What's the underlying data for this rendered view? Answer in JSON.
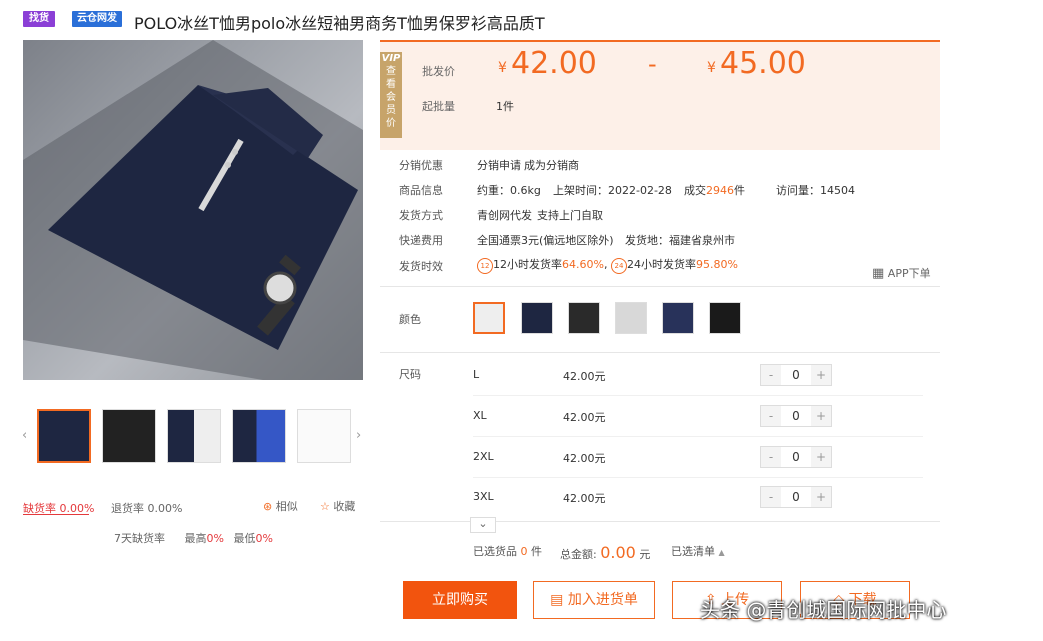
{
  "header": {
    "badge1": "找货",
    "badge2": "云仓网发",
    "title": "POLO冰丝T恤男polo冰丝短袖男商务T恤男保罗衫高品质T"
  },
  "price": {
    "vip_tag": "VIP",
    "vip_lines": [
      "查",
      "看",
      "会",
      "员",
      "价"
    ],
    "wholesale_label": "批发价",
    "currency": "¥",
    "low": "42.00",
    "dash": "-",
    "high": "45.00",
    "min_label": "起批量",
    "min_value": "1件"
  },
  "info": {
    "distribution_label": "分销优惠",
    "distribution_link": "分销申请",
    "distribution_text": "成为分销商",
    "goods_label": "商品信息",
    "weight": "约重：0.6kg",
    "listed": "上架时间：2022-02-28",
    "deals_prefix": "成交",
    "deals_count": "2946",
    "deals_suffix": "件",
    "visits": "访问量：14504",
    "ship_method_label": "发货方式",
    "ship_method_link": "青创网代发",
    "ship_method_text": "支持上门自取",
    "express_label": "快递费用",
    "express_text": "全国通票3元(偏远地区除外)",
    "origin": "发货地：福建省泉州市",
    "timeliness_label": "发货时效",
    "t12_icon": "12",
    "t12_text": "12小时发货率",
    "t12_rate": "64.60%",
    "sep": ",",
    "t24_icon": "24",
    "t24_text": "24小时发货率",
    "t24_rate": "95.80%",
    "app_order": "APP下单"
  },
  "color": {
    "label": "颜色"
  },
  "sizes": {
    "label": "尺码",
    "rows": [
      {
        "size": "L",
        "price": "42.00元",
        "qty": "0"
      },
      {
        "size": "XL",
        "price": "42.00元",
        "qty": "0"
      },
      {
        "size": "2XL",
        "price": "42.00元",
        "qty": "0"
      },
      {
        "size": "3XL",
        "price": "42.00元",
        "qty": "0"
      }
    ],
    "minus": "-",
    "plus": "+",
    "expand": "⌄"
  },
  "summary": {
    "selected_label": "已选货品",
    "selected_count": "0",
    "selected_unit": "件",
    "total_label": "总金额:",
    "total_value": "0.00",
    "total_unit": "元",
    "list_label": "已选清单"
  },
  "stats": {
    "stockout_label": "缺货率",
    "stockout_value": "0.00%",
    "return_label": "退货率",
    "return_value": "0.00%",
    "similar": "相似",
    "favorite": "收藏",
    "seven_day": "7天缺货率",
    "max_label": "最高",
    "max_value": "0%",
    "min_label": "最低",
    "min_value": "0%"
  },
  "actions": {
    "buy": "立即购买",
    "add": "加入进货单",
    "upload": "上传",
    "fourth": "下载"
  },
  "watermark": "头条 @青创城国际网批中心",
  "colors": {
    "accent": "#f26a22",
    "red": "#e4393c",
    "navy": "#1e2641"
  }
}
